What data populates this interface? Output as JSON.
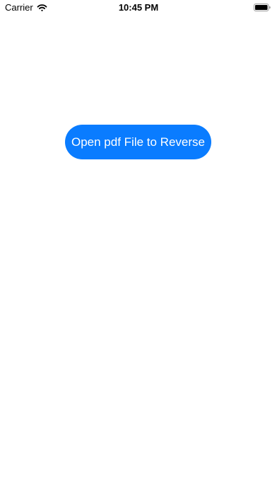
{
  "status_bar": {
    "carrier": "Carrier",
    "time": "10:45 PM",
    "icons": {
      "wifi": "wifi-icon",
      "battery": "battery-icon"
    }
  },
  "main": {
    "open_button_label": "Open pdf File to Reverse"
  },
  "colors": {
    "accent": "#0a7cff",
    "background": "#ffffff",
    "text": "#000000"
  }
}
